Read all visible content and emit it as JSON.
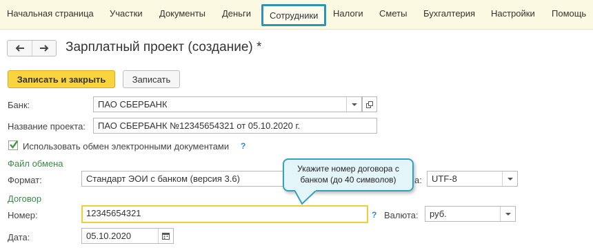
{
  "menu": {
    "items": [
      "Начальная страница",
      "Участки",
      "Документы",
      "Деньги",
      "Сотрудники",
      "Налоги",
      "Сметы",
      "Бухгалтерия",
      "Настройки",
      "Помощь"
    ],
    "active": "Сотрудники"
  },
  "form": {
    "title": "Зарплатный проект (создание) *"
  },
  "toolbar": {
    "save_close_label": "Записать и закрыть",
    "save_label": "Записать"
  },
  "fields": {
    "bank_label": "Банк:",
    "bank_value": "ПАО СБЕРБАНК",
    "project_name_label": "Название проекта:",
    "project_name_value": "ПАО СБЕРБАНК №12345654321 от 05.10.2020 г.",
    "edo_label": "Использовать обмен электронными документами",
    "edo_checked": true,
    "help_mark": "?",
    "exchange_section": "Файл обмена",
    "format_label": "Формат:",
    "format_value": "Стандарт ЭОИ с банком (версия 3.6)",
    "encoding_label_tail": "а:",
    "encoding_value": "UTF-8",
    "contract_section": "Договор",
    "number_label": "Номер:",
    "number_value": "12345654321",
    "currency_label": "Валюта:",
    "currency_value": "руб.",
    "date_label": "Дата:",
    "date_value": "05.10.2020"
  },
  "tooltip": {
    "line1": "Укажите номер договора с",
    "line2": "банком (до 40 символов)"
  },
  "colors": {
    "menu_bg": "#fcf9e3",
    "active_border": "#2b95b9",
    "primary_button": "#fad43f",
    "section_green": "#3a8a47",
    "focus_border": "#f2cc3c",
    "tooltip_bg": "#e3f5f9"
  }
}
